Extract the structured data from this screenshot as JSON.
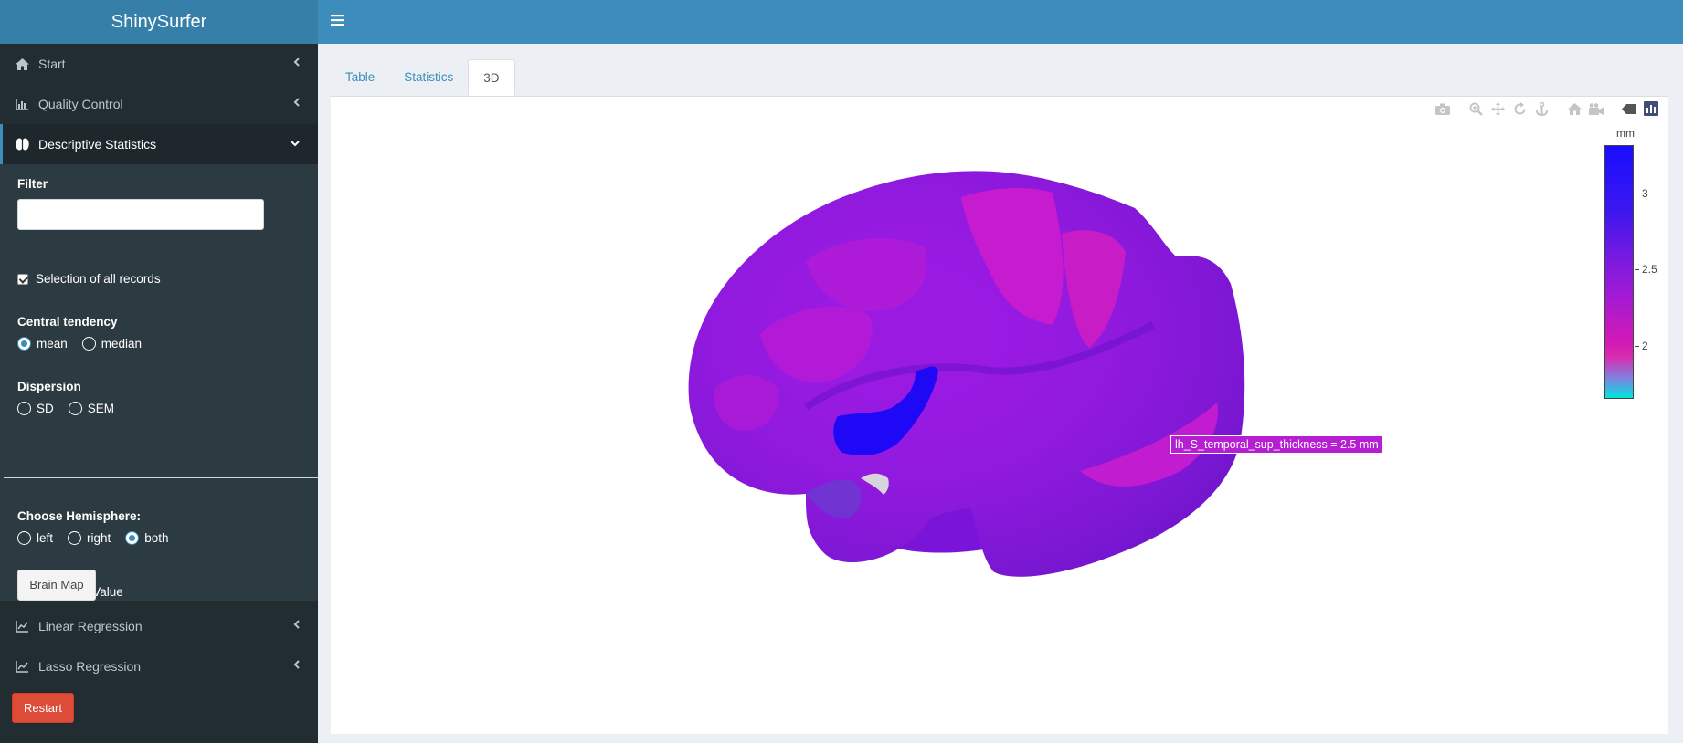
{
  "app": {
    "title": "ShinySurfer"
  },
  "sidebar": {
    "items": [
      {
        "label": "Start",
        "icon": "home-icon"
      },
      {
        "label": "Quality Control",
        "icon": "bar-chart-icon"
      },
      {
        "label": "Descriptive Statistics",
        "icon": "brain-icon",
        "expanded": true
      },
      {
        "label": "Linear Regression",
        "icon": "line-chart-icon"
      },
      {
        "label": "Lasso Regression",
        "icon": "line-chart-icon"
      }
    ],
    "filter": {
      "label": "Filter",
      "value": ""
    },
    "select_all": {
      "label": "Selection of all records",
      "checked": true
    },
    "central_tendency": {
      "label": "Central tendency",
      "options": [
        "mean",
        "median"
      ],
      "selected": "mean"
    },
    "dispersion": {
      "label": "Dispersion",
      "options": [
        "SD",
        "SEM"
      ],
      "selected": null
    },
    "hemisphere": {
      "label": "Choose Hemisphere:",
      "options": [
        "left",
        "right",
        "both"
      ],
      "selected": "both"
    },
    "color_value": {
      "label": "Color and Value",
      "checked": false
    },
    "brain_map_button": "Brain Map",
    "restart_button": "Restart"
  },
  "tabs": [
    {
      "label": "Table",
      "active": false
    },
    {
      "label": "Statistics",
      "active": false
    },
    {
      "label": "3D",
      "active": true
    }
  ],
  "plot": {
    "modebar": [
      "camera-icon",
      "zoom-icon",
      "pan-icon",
      "orbit-rotation-icon",
      "turntable-rotation-icon",
      "reset-camera-icon",
      "save-camera-icon",
      "hover-label-icon",
      "plotly-logo-icon"
    ],
    "colorbar": {
      "unit": "mm",
      "ticks": [
        "3",
        "2.5",
        "2"
      ],
      "colors": [
        "#1a0dff",
        "#a41ad4",
        "#d21ab4",
        "#00e5e0"
      ]
    },
    "hover_label": "lh_S_temporal_sup_thickness =  2.5  mm",
    "accent": "#3c8dbc"
  }
}
